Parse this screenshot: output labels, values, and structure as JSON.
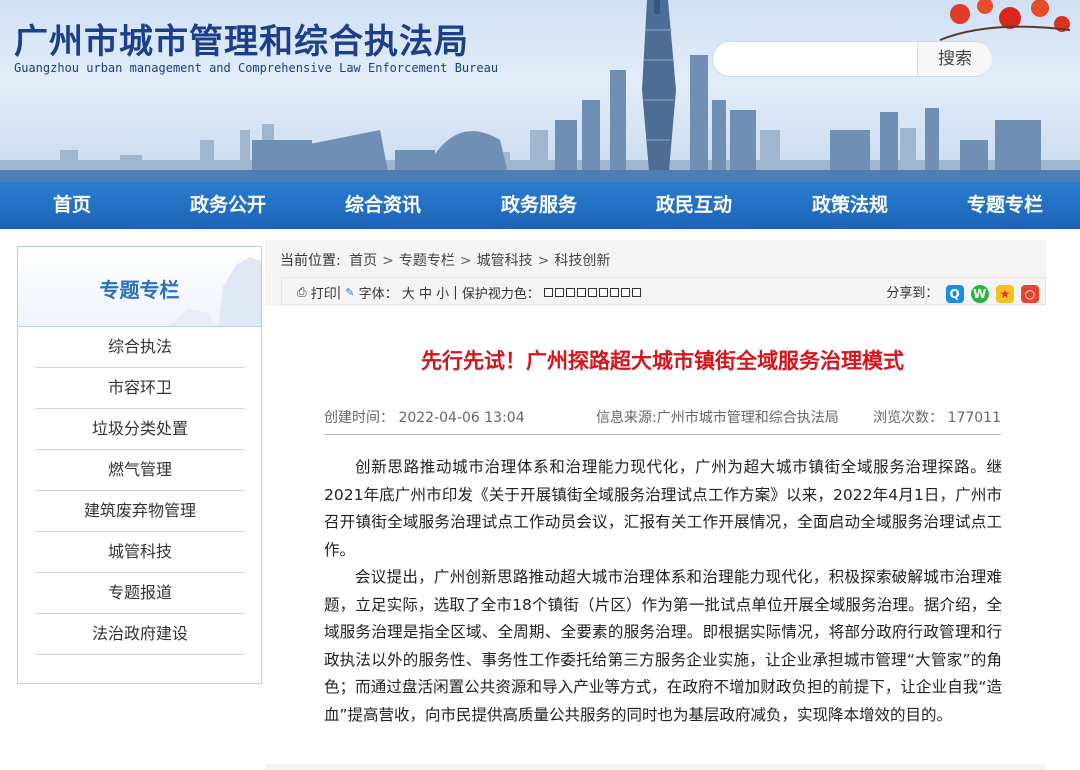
{
  "header": {
    "title": "广州市城市管理和综合执法局",
    "subtitle": "Guangzhou urban management and Comprehensive Law Enforcement Bureau",
    "search": {
      "placeholder": "",
      "button": "搜索"
    }
  },
  "nav": [
    "首页",
    "政务公开",
    "综合资讯",
    "政务服务",
    "政民互动",
    "政策法规",
    "专题专栏"
  ],
  "sidebar": {
    "title": "专题专栏",
    "items": [
      "综合执法",
      "市容环卫",
      "垃圾分类处置",
      "燃气管理",
      "建筑废弃物管理",
      "城管科技",
      "专题报道",
      "法治政府建设"
    ]
  },
  "breadcrumb": {
    "lead": "当前位置:",
    "items": [
      "首页",
      "专题专栏",
      "城管科技",
      "科技创新"
    ]
  },
  "toolbar": {
    "print": "打印",
    "font_label": "字体：",
    "font_sizes": [
      "大",
      "中",
      "小"
    ],
    "eye_label": "保护视力色：",
    "share_label": "分享到："
  },
  "article": {
    "title": "先行先试！广州探路超大城市镇街全域服务治理模式",
    "created": "创建时间： 2022-04-06 13:04",
    "source": "信息来源:广州市城市管理和综合执法局",
    "views": "浏览次数： 177011",
    "paragraphs": [
      "创新思路推动城市治理体系和治理能力现代化，广州为超大城市镇街全域服务治理探路。继2021年底广州市印发《关于开展镇街全域服务治理试点工作方案》以来，2022年4月1日，广州市召开镇街全域服务治理试点工作动员会议，汇报有关工作开展情况，全面启动全域服务治理试点工作。",
      "会议提出，广州创新思路推动超大城市治理体系和治理能力现代化，积极探索破解城市治理难题，立足实际，选取了全市18个镇街（片区）作为第一批试点单位开展全域服务治理。据介绍，全域服务治理是指全区域、全周期、全要素的服务治理。即根据实际情况，将部分政府行政管理和行政执法以外的服务性、事务性工作委托给第三方服务企业实施，让企业承担城市管理“大管家”的角色；而通过盘活闲置公共资源和导入产业等方式，在政府不增加财政负担的前提下，让企业自我“造血”提高营收，向市民提供高质量公共服务的同时也为基层政府减负，实现降本增效的目的。"
    ]
  },
  "colors": {
    "nav_bg": "#1d63b8",
    "title_red": "#d8131a",
    "brand_blue": "#1d3f8a"
  }
}
